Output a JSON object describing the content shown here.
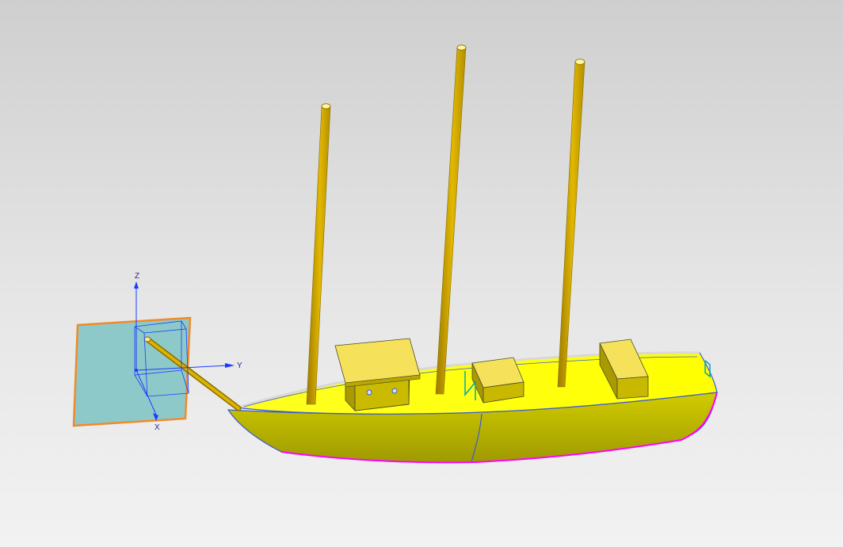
{
  "colors": {
    "background_top": "#cfcfcf",
    "background_bottom": "#f2f2f2",
    "hull_deck": "#ffff00",
    "hull_side": "#b9b400",
    "mast": "#d9ad00",
    "outline_blue": "#3b5bd6",
    "outline_magenta": "#ff00ff",
    "datum_plane_fill": "#8ec9c9",
    "datum_plane_edge": "#f08a2a",
    "csys_blue": "#1a3cff",
    "marker_cyan": "#00a7b4"
  },
  "csys": {
    "z_label": "Z",
    "y_label": "Y",
    "x_label": "X"
  }
}
